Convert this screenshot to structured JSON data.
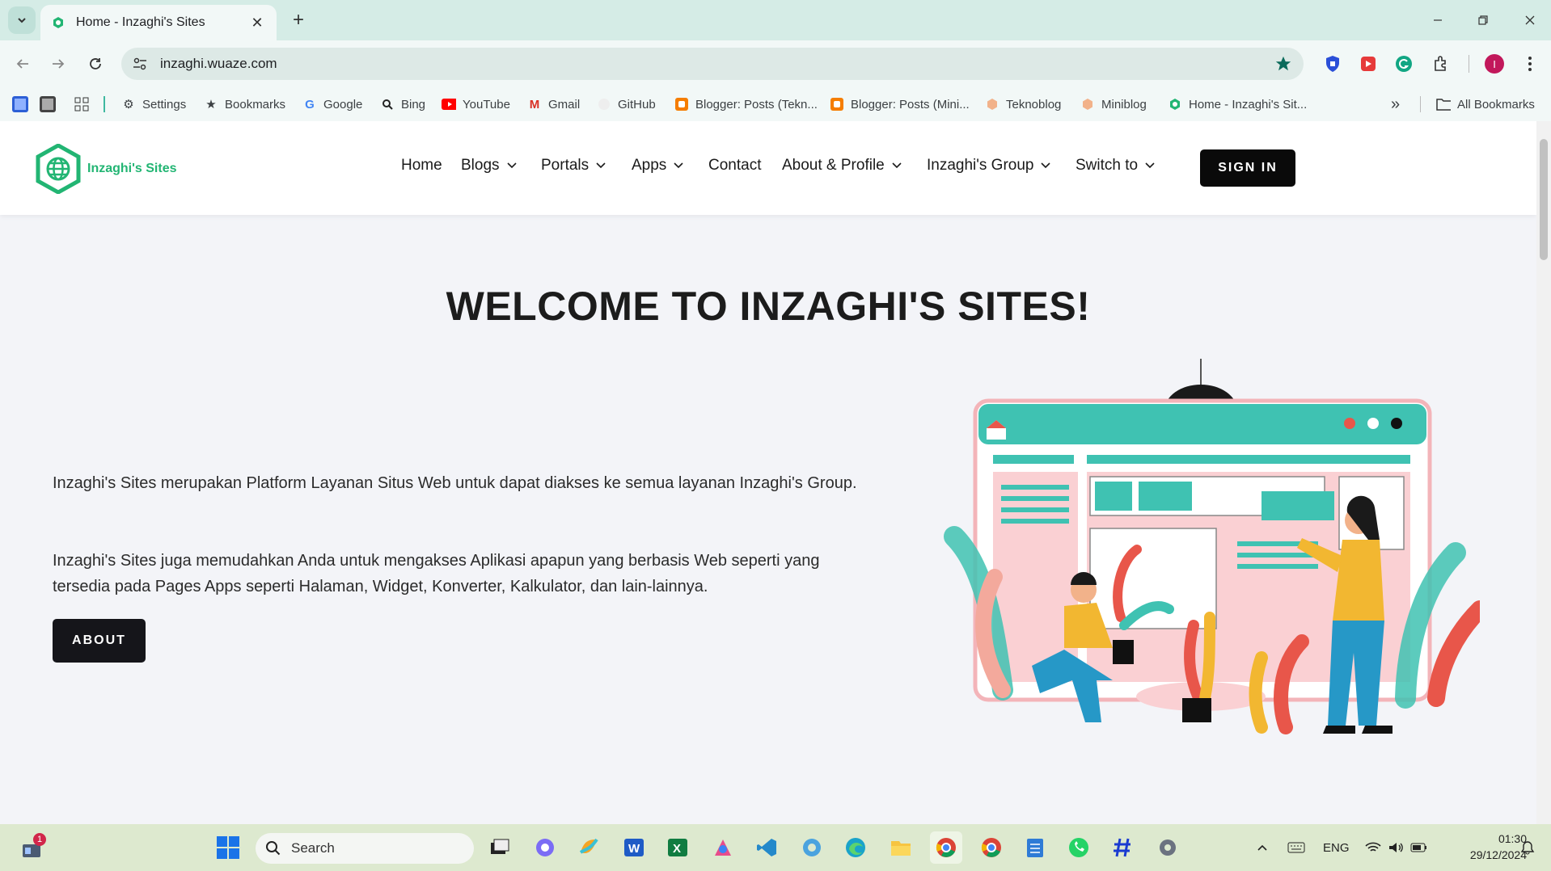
{
  "browser": {
    "tab": {
      "title": "Home - Inzaghi's Sites",
      "favicon": "site-globe-icon"
    },
    "new_tab_label": "+",
    "url": "inzaghi.wuaze.com",
    "profile_initial": "I",
    "bookmarks": [
      {
        "label": "Settings",
        "icon": "gear-icon"
      },
      {
        "label": "Bookmarks",
        "icon": "star-icon"
      },
      {
        "label": "Google",
        "icon": "google-icon"
      },
      {
        "label": "Bing",
        "icon": "search-icon"
      },
      {
        "label": "YouTube",
        "icon": "youtube-icon"
      },
      {
        "label": "Gmail",
        "icon": "gmail-icon"
      },
      {
        "label": "GitHub",
        "icon": "github-icon"
      },
      {
        "label": "Blogger: Posts (Tekn...",
        "icon": "blogger-icon"
      },
      {
        "label": "Blogger: Posts (Mini...",
        "icon": "blogger-icon"
      },
      {
        "label": "Teknoblog",
        "icon": "hexagon-icon"
      },
      {
        "label": "Miniblog",
        "icon": "hexagon-icon"
      },
      {
        "label": "Home - Inzaghi's Sit...",
        "icon": "site-globe-icon"
      }
    ],
    "more_label": "»",
    "all_bookmarks": "All Bookmarks"
  },
  "site": {
    "brand": "Inzaghi's Sites",
    "nav": [
      {
        "label": "Home",
        "dropdown": false
      },
      {
        "label": "Blogs",
        "dropdown": true
      },
      {
        "label": "Portals",
        "dropdown": true
      },
      {
        "label": "Apps",
        "dropdown": true
      },
      {
        "label": "Contact",
        "dropdown": false
      },
      {
        "label": "About & Profile",
        "dropdown": true
      },
      {
        "label": "Inzaghi's Group",
        "dropdown": true
      },
      {
        "label": "Switch to",
        "dropdown": true
      }
    ],
    "signin": "SIGN IN",
    "welcome": "WELCOME TO INZAGHI'S SITES!",
    "para1": "Inzaghi's Sites merupakan Platform Layanan Situs Web untuk dapat diakses ke semua layanan Inzaghi's Group.",
    "para2": "Inzaghi's Sites juga memudahkan Anda untuk mengakses Aplikasi apapun yang berbasis Web seperti yang tersedia pada Pages Apps seperti Halaman, Widget, Konverter, Kalkulator, dan lain-lainnya.",
    "about": "ABOUT",
    "accent": "#22b573"
  },
  "taskbar": {
    "widgets_badge": "1",
    "search_placeholder": "Search",
    "lang": "ENG",
    "time": "01:30",
    "date": "29/12/2024"
  }
}
